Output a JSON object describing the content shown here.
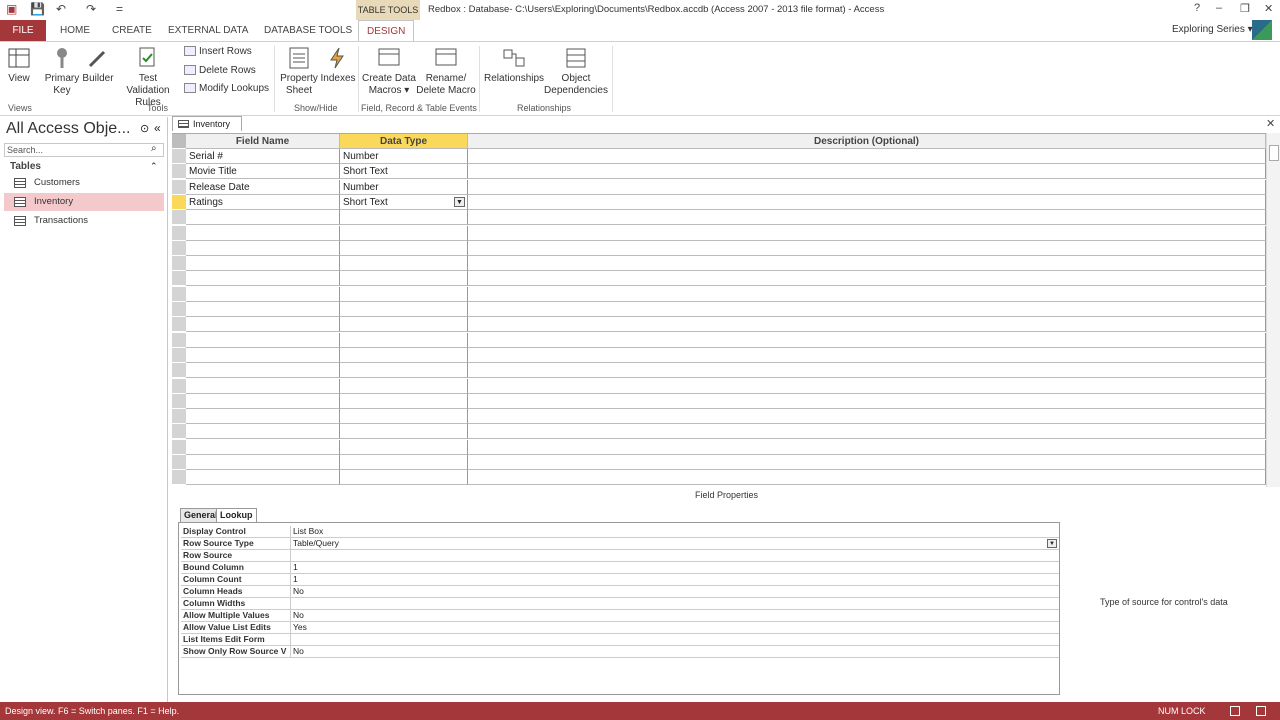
{
  "window": {
    "table_tools_label": "TABLE TOOLS",
    "title": "Redbox : Database- C:\\Users\\Exploring\\Documents\\Redbox.accdb (Access 2007 - 2013 file format) - Access",
    "help": "?",
    "minimize": "–",
    "restore": "❐",
    "close": "✕"
  },
  "quick_access": {
    "save": "💾",
    "undo": "↶",
    "redo": "↷",
    "customize": "="
  },
  "tabs": [
    {
      "label": "FILE"
    },
    {
      "label": "HOME"
    },
    {
      "label": "CREATE"
    },
    {
      "label": "EXTERNAL DATA"
    },
    {
      "label": "DATABASE TOOLS"
    },
    {
      "label": "DESIGN"
    }
  ],
  "user": {
    "name": "Exploring Series ▾"
  },
  "ribbon": {
    "view": "View",
    "primary_key": "Primary Key",
    "builder": "Builder",
    "test_validation": "Test Validation Rules",
    "insert_rows": "Insert Rows",
    "delete_rows": "Delete Rows",
    "modify_lookups": "Modify Lookups",
    "property_sheet": "Property Sheet",
    "indexes": "Indexes",
    "create_data_macros": "Create Data Macros ▾",
    "rename_delete_macro": "Rename/ Delete Macro",
    "relationships": "Relationships",
    "object_dependencies": "Object Dependencies",
    "groups": {
      "views": "Views",
      "tools": "Tools",
      "show_hide": "Show/Hide",
      "field_record": "Field, Record & Table Events",
      "relationships": "Relationships"
    }
  },
  "nav": {
    "title": "All Access Obje...",
    "search_placeholder": "Search...",
    "group": "Tables",
    "items": [
      {
        "label": "Customers"
      },
      {
        "label": "Inventory"
      },
      {
        "label": "Transactions"
      }
    ],
    "collapse": "«"
  },
  "document": {
    "tab": "Inventory",
    "close": "✕",
    "headers": {
      "field": "Field Name",
      "type": "Data Type",
      "desc": "Description (Optional)"
    },
    "rows": [
      {
        "name": "Serial #",
        "type": "Number"
      },
      {
        "name": "Movie Title",
        "type": "Short Text"
      },
      {
        "name": "Release Date",
        "type": "Number"
      },
      {
        "name": "Ratings",
        "type": "Short Text"
      }
    ]
  },
  "field_properties": {
    "label": "Field Properties",
    "tab_general": "General",
    "tab_lookup": "Lookup",
    "props": [
      {
        "name": "Display Control",
        "value": "List Box"
      },
      {
        "name": "Row Source Type",
        "value": "Table/Query"
      },
      {
        "name": "Row Source",
        "value": ""
      },
      {
        "name": "Bound Column",
        "value": "1"
      },
      {
        "name": "Column Count",
        "value": "1"
      },
      {
        "name": "Column Heads",
        "value": "No"
      },
      {
        "name": "Column Widths",
        "value": ""
      },
      {
        "name": "Allow Multiple Values",
        "value": "No"
      },
      {
        "name": "Allow Value List Edits",
        "value": "Yes"
      },
      {
        "name": "List Items Edit Form",
        "value": ""
      },
      {
        "name": "Show Only Row Source V",
        "value": "No"
      }
    ],
    "hint": "Type of source for control's data"
  },
  "status": {
    "text": "Design view.  F6 = Switch panes.  F1 = Help.",
    "numlock": "NUM LOCK"
  },
  "colors": {
    "accent": "#a4373a",
    "selected_nav": "#f4c9cc",
    "active_header": "#fad85a"
  }
}
